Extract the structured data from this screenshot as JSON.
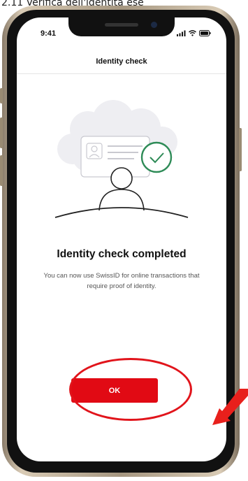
{
  "caption": "2.11 Verifica dell'identità ese",
  "status_bar": {
    "time": "9:41"
  },
  "header": {
    "title": "Identity check"
  },
  "illustration": {
    "icon": "id-card-person-checkmark"
  },
  "main": {
    "headline": "Identity check completed",
    "body": "You can now use SwissID for online transactions that require proof of identity."
  },
  "actions": {
    "ok_label": "OK"
  },
  "colors": {
    "accent": "#e10a14",
    "check_green": "#2e8b57"
  }
}
